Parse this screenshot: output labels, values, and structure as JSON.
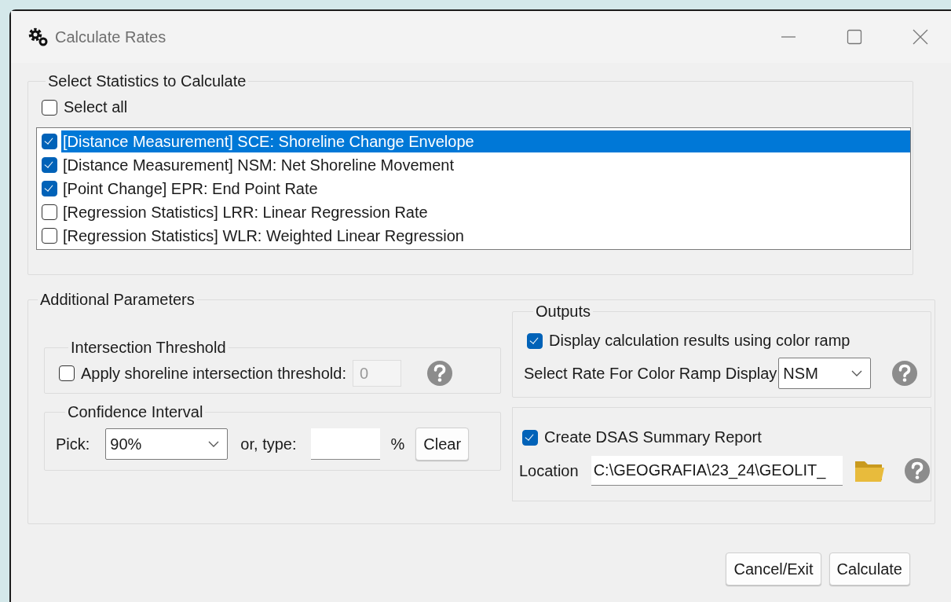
{
  "window": {
    "title": "Calculate Rates"
  },
  "statistics": {
    "title": "Select Statistics to Calculate",
    "select_all": {
      "label": "Select all",
      "checked": false
    },
    "items": [
      {
        "label": "[Distance Measurement] SCE: Shoreline Change Envelope",
        "checked": true,
        "selected": true
      },
      {
        "label": "[Distance Measurement] NSM: Net Shoreline Movement",
        "checked": true,
        "selected": false
      },
      {
        "label": "[Point Change] EPR: End Point Rate",
        "checked": true,
        "selected": false
      },
      {
        "label": "[Regression Statistics] LRR: Linear Regression Rate",
        "checked": false,
        "selected": false
      },
      {
        "label": "[Regression Statistics] WLR: Weighted Linear Regression",
        "checked": false,
        "selected": false
      }
    ]
  },
  "additional_parameters": {
    "title": "Additional Parameters",
    "intersection_threshold": {
      "title": "Intersection Threshold",
      "label": "Apply shoreline intersection threshold:",
      "checked": false,
      "value": "0",
      "disabled": true
    },
    "confidence_interval": {
      "title": "Confidence Interval",
      "pick_label": "Pick:",
      "pick_value": "90%",
      "type_label": "or, type:",
      "unit": "%",
      "clear_button": "Clear"
    }
  },
  "outputs": {
    "title": "Outputs",
    "color_ramp": {
      "label": "Display calculation results using color ramp",
      "checked": true
    },
    "rate_label": "Select Rate For Color Ramp Display",
    "rate_value": "NSM"
  },
  "report": {
    "label": "Create DSAS Summary Report",
    "checked": true,
    "location_label": "Location",
    "location_value": "C:\\GEOGRAFIA\\23_24\\GEOLIT_"
  },
  "buttons": [
    "Cancel/Exit",
    "Calculate"
  ]
}
